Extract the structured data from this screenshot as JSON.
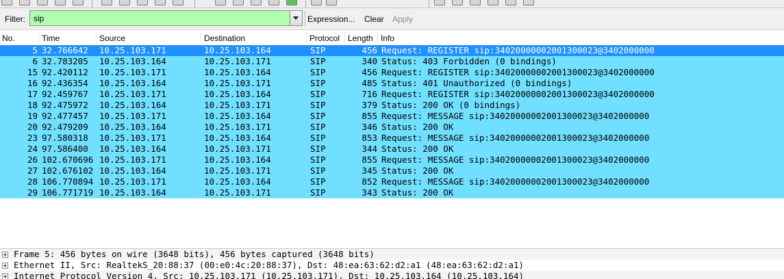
{
  "filter": {
    "label": "Filter:",
    "value": "sip",
    "color": "#afffaf",
    "buttons": {
      "expression": "Expression...",
      "clear": "Clear",
      "apply": "Apply"
    }
  },
  "columns": {
    "no": "No.",
    "time": "Time",
    "source": "Source",
    "destination": "Destination",
    "protocol": "Protocol",
    "length": "Length",
    "info": "Info"
  },
  "colors": {
    "row_bg": "#71dfff",
    "selected_bg": "#1e90ff",
    "selected_fg": "#ffffff"
  },
  "packets": [
    {
      "no": "5",
      "time": "32.766642",
      "source": "10.25.103.171",
      "destination": "10.25.103.164",
      "protocol": "SIP",
      "length": "456",
      "info": "Request: REGISTER sip:34020000002001300023@3402000000",
      "selected": true
    },
    {
      "no": "6",
      "time": "32.783205",
      "source": "10.25.103.164",
      "destination": "10.25.103.171",
      "protocol": "SIP",
      "length": "340",
      "info": "Status: 403 Forbidden    (0 bindings)",
      "selected": false
    },
    {
      "no": "15",
      "time": "92.420112",
      "source": "10.25.103.171",
      "destination": "10.25.103.164",
      "protocol": "SIP",
      "length": "456",
      "info": "Request: REGISTER sip:34020000002001300023@3402000000",
      "selected": false
    },
    {
      "no": "16",
      "time": "92.436354",
      "source": "10.25.103.164",
      "destination": "10.25.103.171",
      "protocol": "SIP",
      "length": "485",
      "info": "Status: 401 Unauthorized    (0 bindings)",
      "selected": false
    },
    {
      "no": "17",
      "time": "92.459767",
      "source": "10.25.103.171",
      "destination": "10.25.103.164",
      "protocol": "SIP",
      "length": "716",
      "info": "Request: REGISTER sip:34020000002001300023@3402000000",
      "selected": false
    },
    {
      "no": "18",
      "time": "92.475972",
      "source": "10.25.103.164",
      "destination": "10.25.103.171",
      "protocol": "SIP",
      "length": "379",
      "info": "Status: 200 OK    (0 bindings)",
      "selected": false
    },
    {
      "no": "19",
      "time": "92.477457",
      "source": "10.25.103.171",
      "destination": "10.25.103.164",
      "protocol": "SIP",
      "length": "855",
      "info": "Request: MESSAGE sip:34020000002001300023@3402000000",
      "selected": false
    },
    {
      "no": "20",
      "time": "92.479209",
      "source": "10.25.103.164",
      "destination": "10.25.103.171",
      "protocol": "SIP",
      "length": "346",
      "info": "Status: 200 OK",
      "selected": false
    },
    {
      "no": "23",
      "time": "97.580318",
      "source": "10.25.103.171",
      "destination": "10.25.103.164",
      "protocol": "SIP",
      "length": "853",
      "info": "Request: MESSAGE sip:34020000002001300023@3402000000",
      "selected": false
    },
    {
      "no": "24",
      "time": "97.586400",
      "source": "10.25.103.164",
      "destination": "10.25.103.171",
      "protocol": "SIP",
      "length": "344",
      "info": "Status: 200 OK",
      "selected": false
    },
    {
      "no": "26",
      "time": "102.670696",
      "source": "10.25.103.171",
      "destination": "10.25.103.164",
      "protocol": "SIP",
      "length": "855",
      "info": "Request: MESSAGE sip:34020000002001300023@3402000000",
      "selected": false
    },
    {
      "no": "27",
      "time": "102.676102",
      "source": "10.25.103.164",
      "destination": "10.25.103.171",
      "protocol": "SIP",
      "length": "345",
      "info": "Status: 200 OK",
      "selected": false
    },
    {
      "no": "28",
      "time": "106.770894",
      "source": "10.25.103.171",
      "destination": "10.25.103.164",
      "protocol": "SIP",
      "length": "852",
      "info": "Request: MESSAGE sip:34020000002001300023@3402000000",
      "selected": false
    },
    {
      "no": "29",
      "time": "106.771719",
      "source": "10.25.103.164",
      "destination": "10.25.103.171",
      "protocol": "SIP",
      "length": "343",
      "info": "Status: 200 OK",
      "selected": false
    }
  ],
  "details": [
    "Frame 5: 456 bytes on wire (3648 bits), 456 bytes captured (3648 bits)",
    "Ethernet II, Src: RealtekS_20:88:37 (00:e0:4c:20:88:37), Dst: 48:ea:63:62:d2:a1 (48:ea:63:62:d2:a1)",
    "Internet Protocol Version 4, Src: 10.25.103.171 (10.25.103.171), Dst: 10.25.103.164 (10.25.103.164)"
  ]
}
